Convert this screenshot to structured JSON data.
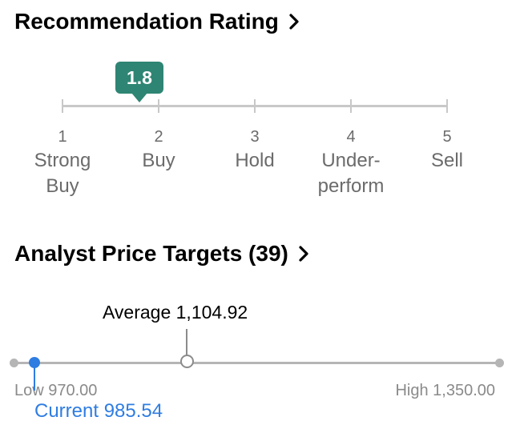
{
  "recommendation": {
    "title": "Recommendation Rating",
    "rating": 1.8,
    "rating_label": "1.8",
    "scale_min": 1,
    "scale_max": 5,
    "scale": [
      {
        "num": "1",
        "label": "Strong\nBuy"
      },
      {
        "num": "2",
        "label": "Buy"
      },
      {
        "num": "3",
        "label": "Hold"
      },
      {
        "num": "4",
        "label": "Under-\nperform"
      },
      {
        "num": "5",
        "label": "Sell"
      }
    ],
    "badge_color": "#2e8573"
  },
  "price_targets": {
    "title": "Analyst Price Targets (39)",
    "low": 970.0,
    "high": 1350.0,
    "average": 1104.92,
    "current": 985.54,
    "average_label": "Average 1,104.92",
    "low_label": "Low 970.00",
    "high_label": "High 1,350.00",
    "current_label": "Current 985.54",
    "current_color": "#2f7de1"
  },
  "icons": {
    "chevron": "chevron-right-icon"
  }
}
